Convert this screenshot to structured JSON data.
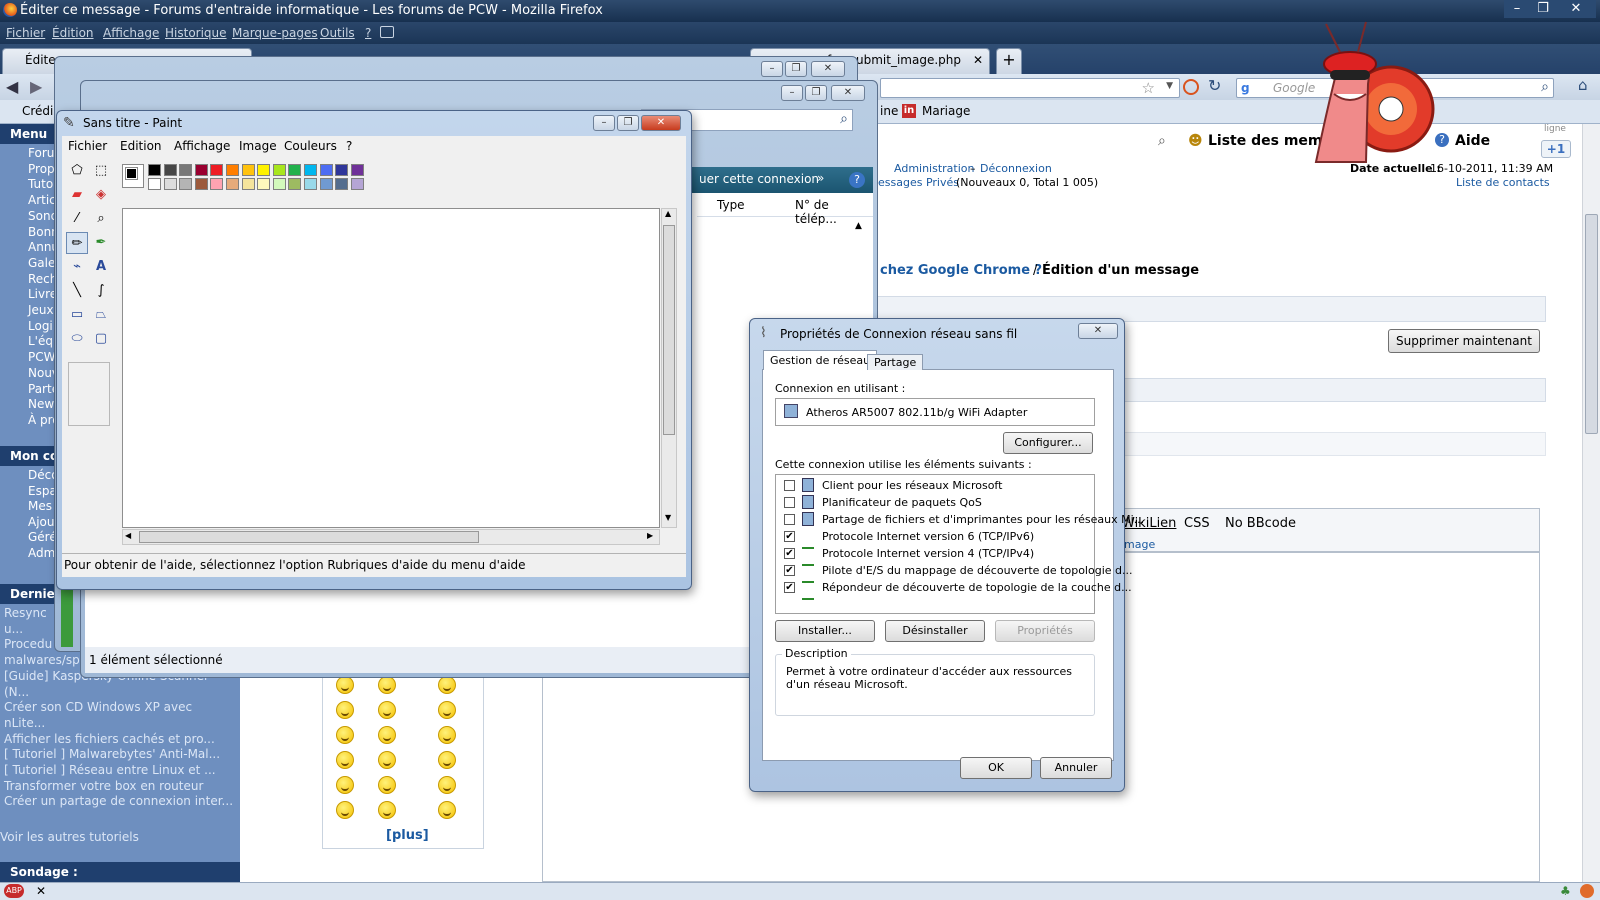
{
  "firefox": {
    "title": "Éditer ce message - Forums d'entraide informatique - Les forums de PCW - Mozilla Firefox",
    "menu": [
      "Fichier",
      "Édition",
      "Affichage",
      "Historique",
      "Marque-pages",
      "Outils",
      "?"
    ],
    "tabs": [
      "Éditer",
      "nfo...submit_image.php"
    ],
    "search_placeholder": "Google",
    "bookmarks": [
      "Crédi",
      "ine",
      "Mariage"
    ],
    "win_controls": [
      "–",
      "❐",
      "✕"
    ]
  },
  "forum": {
    "menu_header": "Menu",
    "left_links": [
      "Foru",
      "Prop",
      "Tuto",
      "Artic",
      "Sond",
      "Bonn",
      "Annu",
      "Gale",
      "Rech",
      "Livre",
      "Jeux",
      "Logi",
      "L'équ",
      "PCW",
      "Nouv",
      "Parte",
      "New",
      "À pro"
    ],
    "account_header": "Mon co",
    "account_links": [
      "Déco",
      "Espa",
      "Mes",
      "Ajou",
      "Géré",
      "Adm"
    ],
    "last_header": "Derniers",
    "tutorials": [
      "Resync",
      "u...",
      "Procedu",
      "malwares/sp",
      "[Guide] Kaspersky Online Scanner",
      "(N...",
      "Créer son CD Windows XP avec",
      "nLite...",
      "Afficher les fichiers cachés et pro...",
      "[ Tutoriel ] Malwarebytes' Anti-Mal...",
      "[ Tutoriel ] Réseau entre Linux et ...",
      "Transformer votre box en routeur",
      "Créer un partage de connexion inter..."
    ],
    "other_tutorials": "Voir les autres tutoriels",
    "poll_header": "Sondage :",
    "more_smileys": "[plus]",
    "member_list": "Liste des memb",
    "help": "Aide",
    "admin_link": "Administration",
    "logout_link": "Déconnexion",
    "pm_text": "essages Privés",
    "pm_counts": "(Nouveaux 0, Total 1 005)",
    "date_label": "Date actuelle :",
    "date_value": "16-10-2011, 11:39 AM",
    "contacts": "Liste de contacts",
    "breadcrumb_link": "chez Google Chrome ?",
    "breadcrumb_sep": "/",
    "breadcrumb_current": "Édition d'un message",
    "delete_button": "Supprimer maintenant",
    "toolbar_items": [
      "WikiLien",
      "CSS",
      "No BBcode"
    ],
    "toolbar_sub": "mage",
    "plusone": "+1",
    "ligne": "ligne"
  },
  "explorer": {
    "connect_text": "uer cette connexion",
    "col_type": "Type",
    "col_phone": "N° de télép...",
    "status": "1 élément sélectionné"
  },
  "paint": {
    "title": "Sans titre - Paint",
    "menu": [
      "Fichier",
      "Edition",
      "Affichage",
      "Image",
      "Couleurs",
      "?"
    ],
    "status": "Pour obtenir de l'aide, sélectionnez l'option Rubriques d'aide du menu d'aide",
    "palette_top": [
      "#000000",
      "#464646",
      "#787878",
      "#990030",
      "#ed1c24",
      "#ff7e00",
      "#ffc20e",
      "#fff200",
      "#a8e61d",
      "#22b14c",
      "#00b7ef",
      "#4d6df3",
      "#2f3699",
      "#6f3198"
    ],
    "palette_bottom": [
      "#ffffff",
      "#dcdcdc",
      "#b4b4b4",
      "#9c5a3c",
      "#ffa3b1",
      "#e5aa7a",
      "#f5e49c",
      "#fff9bd",
      "#d3f9bc",
      "#9dbb61",
      "#99d9ea",
      "#709ad1",
      "#546d8e",
      "#b5a5d5"
    ]
  },
  "netdialog": {
    "title": "Propriétés de Connexion réseau sans fil",
    "tab_network": "Gestion de réseau",
    "tab_share": "Partage",
    "connect_using": "Connexion en utilisant :",
    "adapter": "Atheros AR5007 802.11b/g WiFi Adapter",
    "configure": "Configurer...",
    "items_label": "Cette connexion utilise les éléments suivants :",
    "items": [
      {
        "label": "Client pour les réseaux Microsoft",
        "checked": false
      },
      {
        "label": "Planificateur de paquets QoS",
        "checked": false
      },
      {
        "label": "Partage de fichiers et d'imprimantes pour les réseaux Mi...",
        "checked": false
      },
      {
        "label": "Protocole Internet version 6 (TCP/IPv6)",
        "checked": true
      },
      {
        "label": "Protocole Internet version 4 (TCP/IPv4)",
        "checked": true
      },
      {
        "label": "Pilote d'E/S du mappage de découverte de topologie d...",
        "checked": true
      },
      {
        "label": "Répondeur de découverte de topologie de la couche d...",
        "checked": true
      }
    ],
    "install": "Installer...",
    "uninstall": "Désinstaller",
    "properties": "Propriétés",
    "description_title": "Description",
    "description": "Permet à votre ordinateur d'accéder aux ressources d'un réseau Microsoft.",
    "ok": "OK",
    "cancel": "Annuler"
  }
}
